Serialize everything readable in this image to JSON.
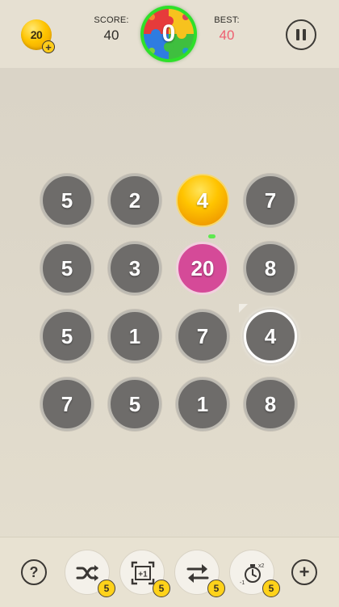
{
  "header": {
    "coins": "20",
    "coin_plus": "+",
    "score_label": "SCORE:",
    "score_value": "40",
    "current_value": "0",
    "best_label": "BEST:",
    "best_value": "40"
  },
  "board": {
    "rows": [
      [
        "5",
        "2",
        "4",
        "7"
      ],
      [
        "5",
        "3",
        "20",
        "8"
      ],
      [
        "5",
        "1",
        "7",
        "4"
      ],
      [
        "7",
        "5",
        "1",
        "8"
      ]
    ]
  },
  "footer": {
    "help_label": "?",
    "add_label": "+",
    "powerups": [
      {
        "name": "shuffle",
        "count": "5"
      },
      {
        "name": "plus-one",
        "count": "5",
        "icon_text": "+1"
      },
      {
        "name": "swap",
        "count": "5"
      },
      {
        "name": "timer",
        "count": "5",
        "icon_left": "-1",
        "icon_right": "x2"
      }
    ]
  },
  "colors": {
    "background": "#ddd7c9",
    "tile_gray": "#6e6c6a",
    "tile_gold": "#ffc400",
    "tile_pink": "#d54a98",
    "best_value": "#ee5f70",
    "badge_ring": "#2ee02a",
    "power_count": "#ffd21a"
  },
  "icons": [
    "coin-icon",
    "puzzle-icon",
    "pause-icon",
    "help-icon",
    "shuffle-icon",
    "plus-one-icon",
    "swap-icon",
    "timer-icon",
    "add-icon"
  ]
}
